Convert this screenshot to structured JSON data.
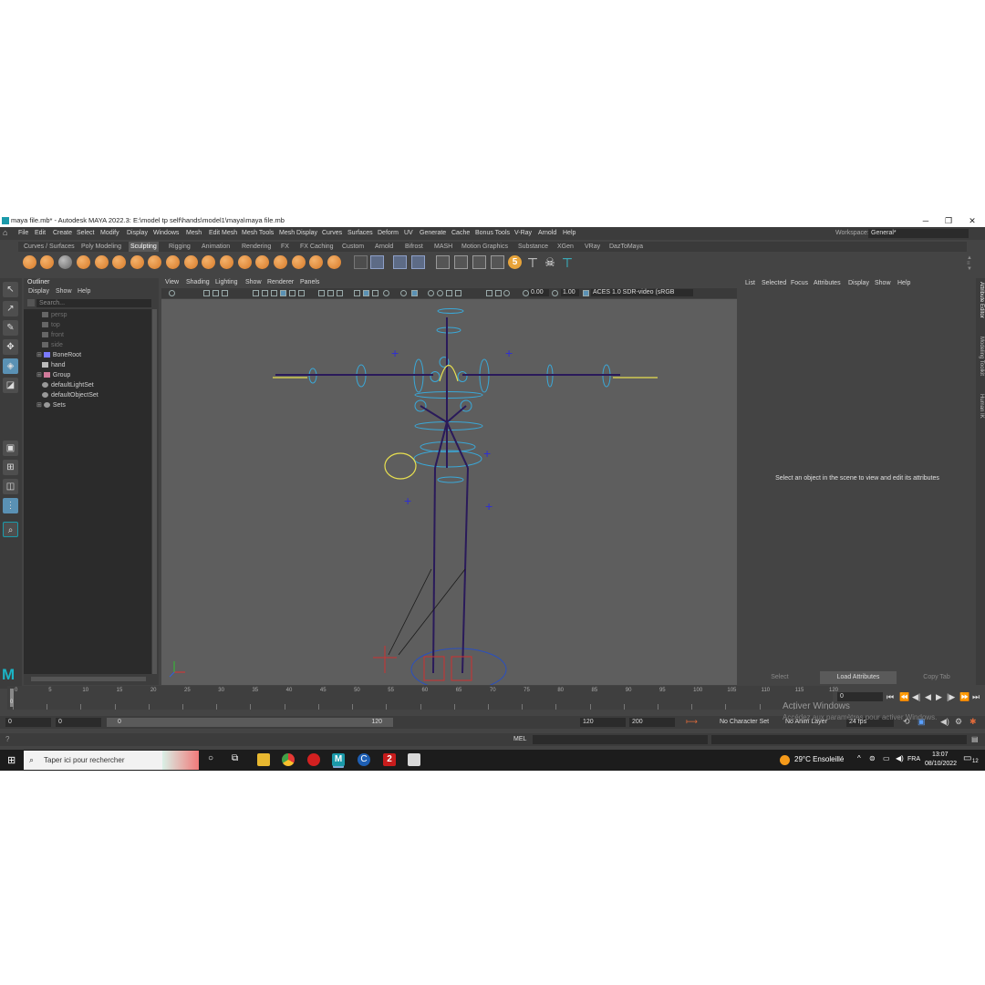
{
  "window": {
    "title": "maya file.mb* - Autodesk MAYA 2022.3: E:\\model tp self\\hands\\model1\\maya\\maya file.mb",
    "minimize": "─",
    "maximize": "❐",
    "close": "✕"
  },
  "menu": [
    "File",
    "Edit",
    "Create",
    "Select",
    "Modify",
    "Display",
    "Windows",
    "Mesh",
    "Edit Mesh",
    "Mesh Tools",
    "Mesh Display",
    "Curves",
    "Surfaces",
    "Deform",
    "UV",
    "Generate",
    "Cache",
    "Bonus Tools",
    "V-Ray",
    "Arnold",
    "Help"
  ],
  "workspace": {
    "label": "Workspace:",
    "value": "General*"
  },
  "shelf_tabs": [
    "Curves / Surfaces",
    "Poly Modeling",
    "Sculpting",
    "Rigging",
    "Animation",
    "Rendering",
    "FX",
    "FX Caching",
    "Custom",
    "Arnold",
    "Bifrost",
    "MASH",
    "Motion Graphics",
    "Substance",
    "XGen",
    "VRay",
    "DazToMaya"
  ],
  "shelf_active": "Sculpting",
  "shelf_badge": "5",
  "outliner": {
    "title": "Outliner",
    "menu": [
      "Display",
      "Show",
      "Help"
    ],
    "search_placeholder": "Search...",
    "items": [
      {
        "label": "persp",
        "dim": true
      },
      {
        "label": "top",
        "dim": true
      },
      {
        "label": "front",
        "dim": true
      },
      {
        "label": "side",
        "dim": true
      },
      {
        "label": "BoneRoot",
        "dim": false
      },
      {
        "label": "hand",
        "dim": false
      },
      {
        "label": "Group",
        "dim": false
      },
      {
        "label": "defaultLightSet",
        "dim": false
      },
      {
        "label": "defaultObjectSet",
        "dim": false
      },
      {
        "label": "Sets",
        "dim": false
      }
    ]
  },
  "viewport": {
    "menu": [
      "View",
      "Shading",
      "Lighting",
      "Show",
      "Renderer",
      "Panels"
    ],
    "field1": "0.00",
    "field2": "1.00",
    "colorspace": "ACES 1.0 SDR-video (sRGB"
  },
  "attribute_editor": {
    "menu": [
      "List",
      "Selected",
      "Focus",
      "Attributes",
      "Display",
      "Show",
      "Help"
    ],
    "message": "Select an object in the scene to view and edit its attributes",
    "buttons": [
      "Select",
      "Load Attributes",
      "Copy Tab"
    ]
  },
  "side_tabs": [
    "Attribute Editor",
    "Modeling Toolkit",
    "Human IK"
  ],
  "timeline": {
    "ticks": [
      "0",
      "5",
      "10",
      "15",
      "20",
      "25",
      "30",
      "35",
      "40",
      "45",
      "50",
      "55",
      "60",
      "65",
      "70",
      "75",
      "80",
      "85",
      "90",
      "95",
      "100",
      "105",
      "110",
      "115",
      "120"
    ],
    "current": "0"
  },
  "range": {
    "start": "0",
    "inner_start": "0",
    "slider_start": "0",
    "slider_end": "120",
    "end": "120",
    "max": "200",
    "character_set": "No Character Set",
    "anim_layer": "No Anim Layer",
    "fps": "24 fps"
  },
  "command": {
    "lang": "MEL"
  },
  "activation": {
    "line1": "Activer Windows",
    "line2": "Accédez aux paramètres pour activer Windows."
  },
  "taskbar": {
    "search": "Taper ici pour rechercher",
    "weather": "29°C  Ensoleillé",
    "lang": "FRA",
    "time": "13:07",
    "date": "08/10/2022",
    "notifications": "12"
  }
}
